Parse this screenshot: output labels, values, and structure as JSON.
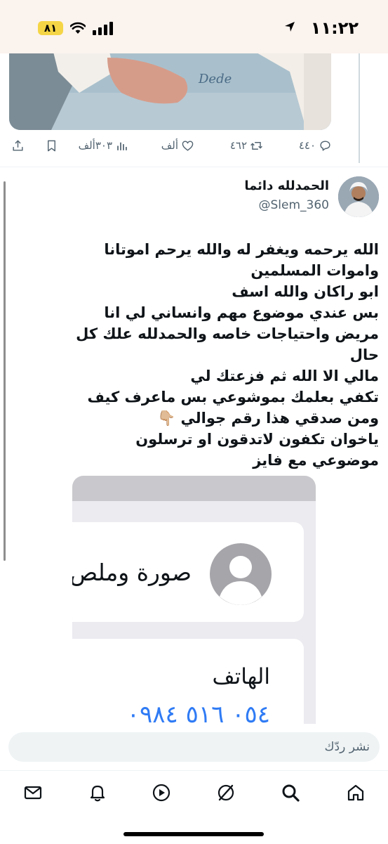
{
  "status_bar": {
    "time": "١١:٢٢",
    "battery": "٨١"
  },
  "tweet_above": {
    "media_watermark": "Dede",
    "actions": {
      "replies": "٤٤٠",
      "retweets": "٤٦٢",
      "likes": "ألف",
      "views": "٣٠٣ألف"
    }
  },
  "reply_tweet": {
    "author_name": "الحمدلله دائما",
    "author_handle": "@Slem_360",
    "text": "الله يرحمه ويغفر له والله يرحم اموتانا واموات المسلمين\nابو راكان والله اسف\nبس عندي موضوع مهم وانساني لي انا\nمريض واحتياجات خاصه والحمدلله علك كل حال\nمالي الا الله ثم فزعتك لي\nتكفي بعلمك بموشوعي بس ماعرف كيف\nومن صدقي هذا رقم جوالي 👇🏼\nياخوان تكفون لاتدقون او ترسلون\nموضوعي مع فايز"
  },
  "embedded_image": {
    "contact_line": "صورة وملص",
    "phone_label": "الهاتف",
    "phone_number": "٠٥٤ ٥١٦ ٠٩٨٤"
  },
  "reply_bar": {
    "placeholder": "نشر ردّك"
  },
  "tab_bar": [
    "home-icon",
    "search-icon",
    "grok-icon",
    "video-icon",
    "bell-icon",
    "mail-icon"
  ],
  "colors": {
    "link_blue": "#2f7bf5",
    "muted": "#536471",
    "battery_yellow": "#f5d546"
  }
}
